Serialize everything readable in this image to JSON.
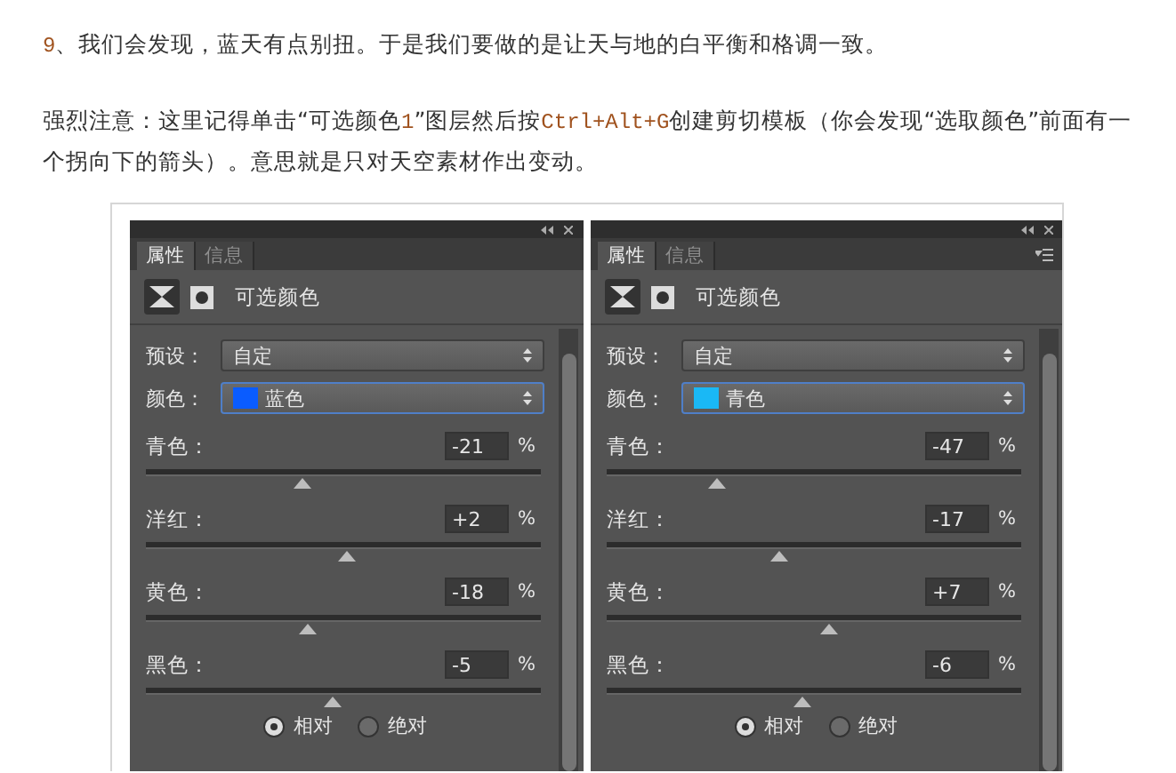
{
  "article": {
    "paragraphs": [
      {
        "segments": [
          {
            "text": "9",
            "kind": "code"
          },
          {
            "text": "、我们会发现，蓝天有点别扭。于是我们要做的是让天与地的白平衡和格调一致。",
            "kind": "plain"
          }
        ]
      },
      {
        "segments": [
          {
            "text": "强烈注意：这里记得单击“可选颜色",
            "kind": "plain"
          },
          {
            "text": "1",
            "kind": "code"
          },
          {
            "text": "”图层然后按",
            "kind": "plain"
          },
          {
            "text": "Ctrl+Alt+G",
            "kind": "code"
          },
          {
            "text": "创建剪切模板（你会发现“选取颜色”前面有一个拐向下的箭头）。意思就是只对天空素材作出变动。",
            "kind": "plain"
          }
        ]
      }
    ]
  },
  "panels": [
    {
      "has_menu": false,
      "tabs": [
        {
          "label": "属性",
          "selected": true
        },
        {
          "label": "信息",
          "selected": false
        }
      ],
      "title": "可选颜色",
      "preset": {
        "label": "预设：",
        "value": "自定"
      },
      "color": {
        "label": "颜色：",
        "value": "蓝色",
        "color": "#0a5cff"
      },
      "sliders": [
        {
          "name": "青色：",
          "value": "-21",
          "unit": "%",
          "level": 0.395
        },
        {
          "name": "洋红：",
          "value": "+2",
          "unit": "%",
          "level": 0.51
        },
        {
          "name": "黄色：",
          "value": "-18",
          "unit": "%",
          "level": 0.41
        },
        {
          "name": "黑色：",
          "value": "-5",
          "unit": "%",
          "level": 0.475
        }
      ],
      "radios": [
        {
          "label": "相对",
          "selected": true
        },
        {
          "label": "绝对",
          "selected": false
        }
      ]
    },
    {
      "has_menu": true,
      "tabs": [
        {
          "label": "属性",
          "selected": true
        },
        {
          "label": "信息",
          "selected": false
        }
      ],
      "title": "可选颜色",
      "preset": {
        "label": "预设：",
        "value": "自定"
      },
      "color": {
        "label": "颜色：",
        "value": "青色",
        "color": "#1ab8f5"
      },
      "sliders": [
        {
          "name": "青色：",
          "value": "-47",
          "unit": "%",
          "level": 0.265
        },
        {
          "name": "洋红：",
          "value": "-17",
          "unit": "%",
          "level": 0.415
        },
        {
          "name": "黄色：",
          "value": "+7",
          "unit": "%",
          "level": 0.535
        },
        {
          "name": "黑色：",
          "value": "-6",
          "unit": "%",
          "level": 0.47
        }
      ],
      "radios": [
        {
          "label": "相对",
          "selected": true
        },
        {
          "label": "绝对",
          "selected": false
        }
      ]
    }
  ]
}
